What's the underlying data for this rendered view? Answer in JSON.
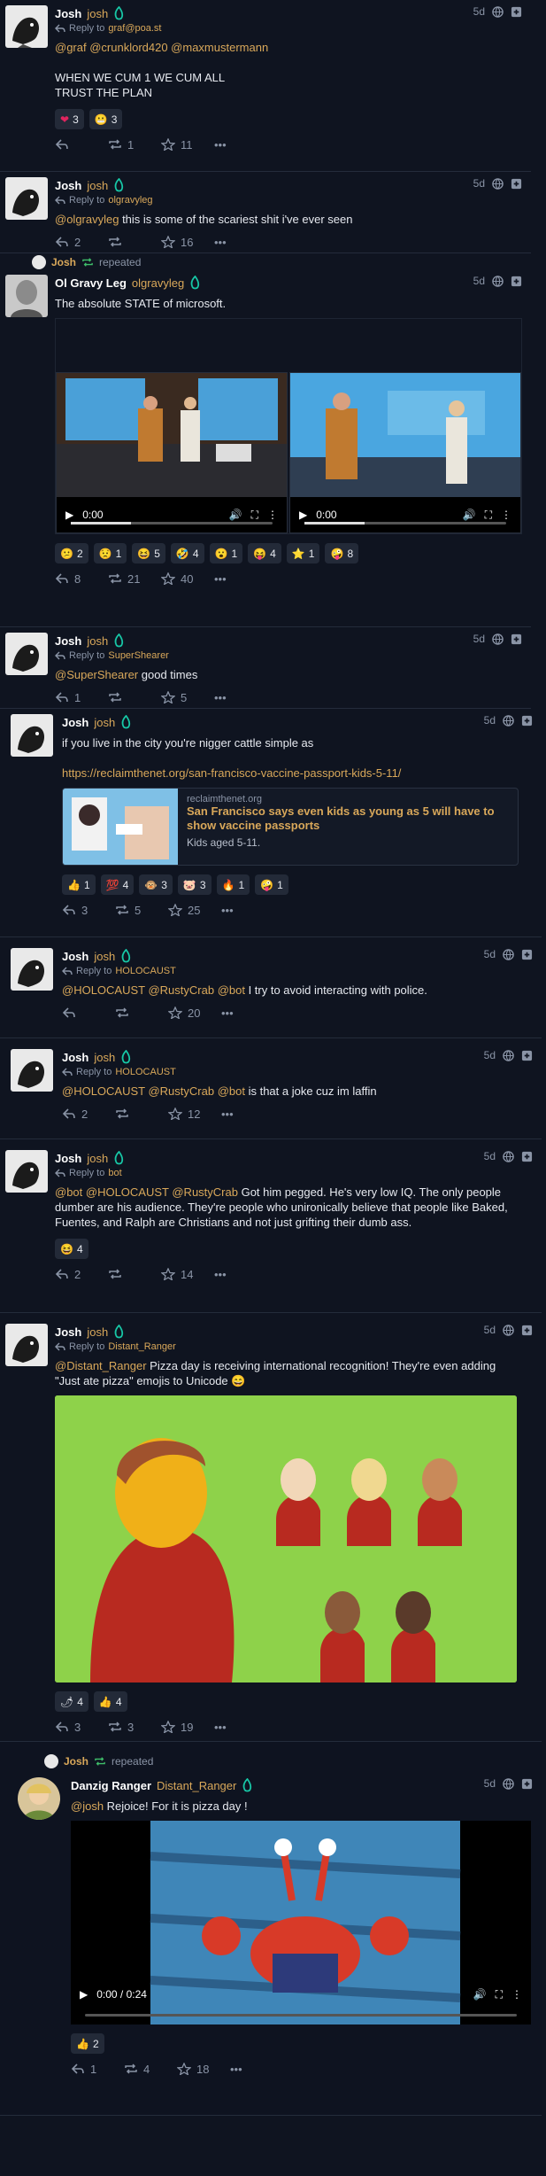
{
  "posts": [
    {
      "display_name": "Josh",
      "handle": "josh",
      "time": "5d",
      "reply_prefix": "Reply to",
      "reply_to": "graf@poa.st",
      "mentions": "@graf @crunklord420 @maxmustermann",
      "text_line1": "WHEN WE CUM 1 WE CUM ALL",
      "text_line2": "TRUST THE PLAN",
      "reactions": [
        {
          "emoji": "❤",
          "count": "3"
        },
        {
          "emoji": "😬",
          "count": "3"
        }
      ],
      "replies": "",
      "repeats": "1",
      "favs": "11"
    },
    {
      "display_name": "Josh",
      "handle": "josh",
      "time": "5d",
      "reply_prefix": "Reply to",
      "reply_to": "olgravyleg",
      "mention": "@olgravyleg",
      "text": " this is some of the scariest shit i've ever seen",
      "replies": "2",
      "repeats": "",
      "favs": "16"
    },
    {
      "repeater": "Josh",
      "repeated_label": "repeated",
      "display_name": "Ol Gravy Leg",
      "handle": "olgravyleg",
      "time": "5d",
      "text": "The absolute STATE of microsoft.",
      "video1_time": "0:00",
      "video2_time": "0:00",
      "reactions": [
        {
          "emoji": "😕",
          "count": "2"
        },
        {
          "emoji": "😟",
          "count": "1"
        },
        {
          "emoji": "😆",
          "count": "5"
        },
        {
          "emoji": "🤣",
          "count": "4"
        },
        {
          "emoji": "😮",
          "count": "1"
        },
        {
          "emoji": "😝",
          "count": "4"
        },
        {
          "emoji": "⭐",
          "count": "1"
        },
        {
          "emoji": "🤪",
          "count": "8"
        }
      ],
      "replies": "8",
      "repeats": "21",
      "favs": "40"
    },
    {
      "display_name": "Josh",
      "handle": "josh",
      "time": "5d",
      "reply_prefix": "Reply to",
      "reply_to": "SuperShearer",
      "mention": "@SuperShearer",
      "text": " good times",
      "replies": "1",
      "repeats": "",
      "favs": "5"
    },
    {
      "display_name": "Josh",
      "handle": "josh",
      "time": "5d",
      "text": "if you live in the city you're nigger cattle simple as",
      "link": "https://reclaimthenet.org/san-francisco-vaccine-passport-kids-5-11/",
      "card_site": "reclaimthenet.org",
      "card_title": "San Francisco says even kids as young as 5 will have to show vaccine passports",
      "card_desc": "Kids aged 5-11.",
      "reactions": [
        {
          "emoji": "👍",
          "count": "1"
        },
        {
          "emoji": "💯",
          "count": "4"
        },
        {
          "emoji": "🐵",
          "count": "3"
        },
        {
          "emoji": "🐷",
          "count": "3"
        },
        {
          "emoji": "🔥",
          "count": "1"
        },
        {
          "emoji": "🤪",
          "count": "1"
        }
      ],
      "replies": "3",
      "repeats": "5",
      "favs": "25"
    },
    {
      "display_name": "Josh",
      "handle": "josh",
      "time": "5d",
      "reply_prefix": "Reply to",
      "reply_to": "HOLOCAUST",
      "mention": "@HOLOCAUST @RustyCrab @bot",
      "text": " I try to avoid interacting with police.",
      "replies": "",
      "repeats": "",
      "favs": "20"
    },
    {
      "display_name": "Josh",
      "handle": "josh",
      "time": "5d",
      "reply_prefix": "Reply to",
      "reply_to": "HOLOCAUST",
      "mention": "@HOLOCAUST @RustyCrab @bot",
      "text": " is that a joke cuz im laffin",
      "replies": "2",
      "repeats": "",
      "favs": "12"
    },
    {
      "display_name": "Josh",
      "handle": "josh",
      "time": "5d",
      "reply_prefix": "Reply to",
      "reply_to": "bot",
      "mention": "@bot @HOLOCAUST @RustyCrab",
      "text": " Got him pegged. He's very low IQ. The only people dumber are his audience. They're people who unironically believe that people like Baked, Fuentes, and Ralph are Christians and not just grifting their dumb ass.",
      "reactions": [
        {
          "emoji": "😆",
          "count": "4"
        }
      ],
      "replies": "2",
      "repeats": "",
      "favs": "14"
    },
    {
      "display_name": "Josh",
      "handle": "josh",
      "time": "5d",
      "reply_prefix": "Reply to",
      "reply_to": "Distant_Ranger",
      "mention": "@Distant_Ranger",
      "text": " Pizza day is receiving international recognition! They're even adding \"Just ate pizza\" emojis to Unicode 😄",
      "reactions": [
        {
          "emoji": "🌶",
          "count": "4"
        },
        {
          "emoji": "👍",
          "count": "4"
        }
      ],
      "replies": "3",
      "repeats": "3",
      "favs": "19"
    },
    {
      "repeater": "Josh",
      "repeated_label": "repeated",
      "display_name": "Danzig Ranger",
      "handle": "Distant_Ranger",
      "time": "5d",
      "mention": "@josh",
      "text": " Rejoice! For it is pizza day !",
      "video_time": "0:00 / 0:24",
      "reactions": [
        {
          "emoji": "👍",
          "count": "2"
        }
      ],
      "replies": "1",
      "repeats": "4",
      "favs": "18"
    }
  ],
  "colors": {
    "accent": "#d9a85a",
    "background": "#0f1420",
    "verified": "#17c7a6"
  }
}
